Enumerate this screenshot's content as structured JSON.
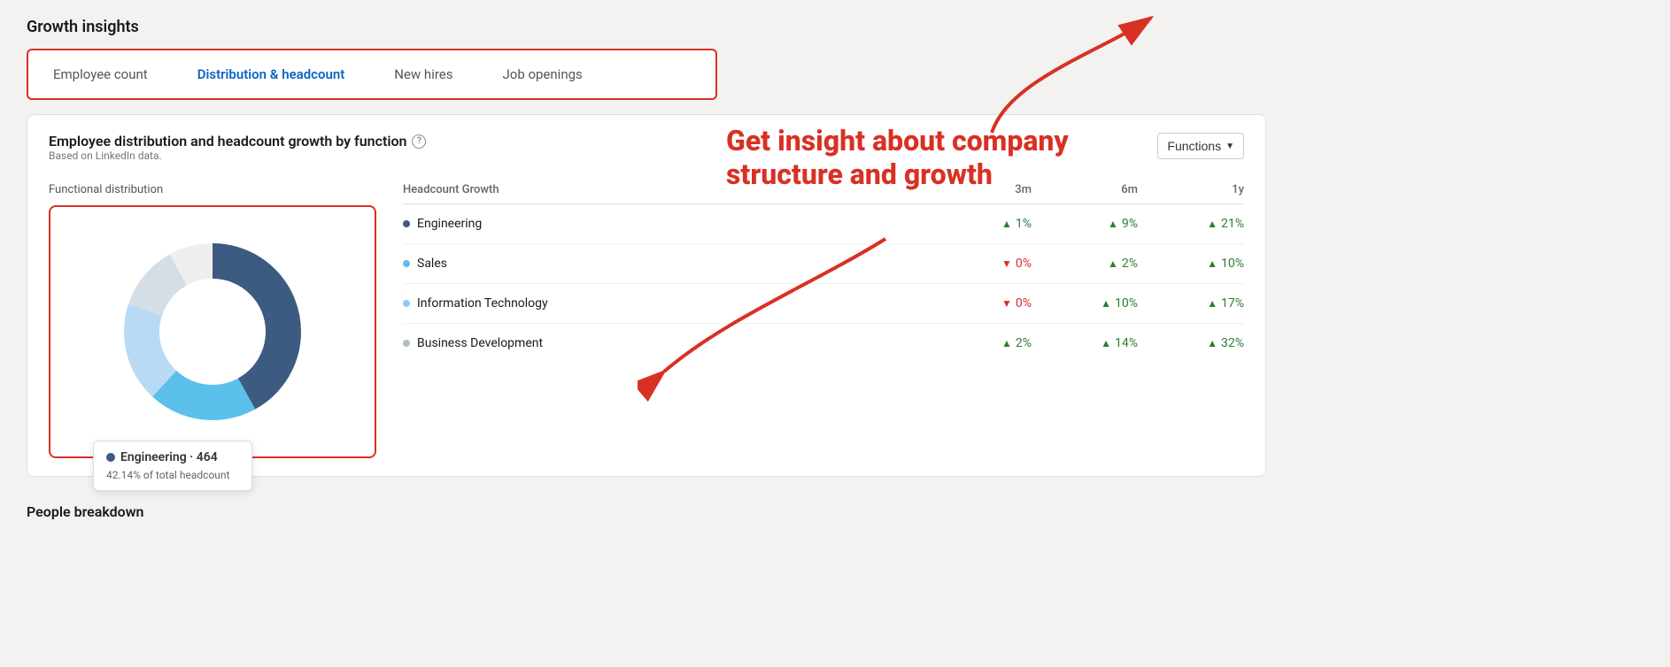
{
  "page": {
    "section_title": "Growth insights",
    "tabs": [
      {
        "id": "employee-count",
        "label": "Employee count",
        "active": false
      },
      {
        "id": "distribution-headcount",
        "label": "Distribution & headcount",
        "active": true
      },
      {
        "id": "new-hires",
        "label": "New hires",
        "active": false
      },
      {
        "id": "job-openings",
        "label": "Job openings",
        "active": false
      }
    ],
    "card": {
      "title": "Employee distribution and headcount growth by function",
      "subtitle": "Based on LinkedIn data.",
      "functions_button": "Functions",
      "chart_label": "Functional distribution",
      "tooltip": {
        "name": "Engineering",
        "count": "464",
        "percent": "42.14% of total headcount"
      },
      "table_headers": {
        "function": "Headcount Growth",
        "col3m": "3m",
        "col6m": "6m",
        "col1y": "1y"
      },
      "rows": [
        {
          "name": "Engineering",
          "dot_color": "#3d5a80",
          "m3": {
            "dir": "up",
            "val": "1%"
          },
          "m6": {
            "dir": "up",
            "val": "9%"
          },
          "y1": {
            "dir": "up",
            "val": "21%"
          }
        },
        {
          "name": "Sales",
          "dot_color": "#5bc0eb",
          "m3": {
            "dir": "down",
            "val": "0%"
          },
          "m6": {
            "dir": "up",
            "val": "2%"
          },
          "y1": {
            "dir": "up",
            "val": "10%"
          }
        },
        {
          "name": "Information Technology",
          "dot_color": "#90caf9",
          "m3": {
            "dir": "down",
            "val": "0%"
          },
          "m6": {
            "dir": "up",
            "val": "10%"
          },
          "y1": {
            "dir": "up",
            "val": "17%"
          }
        },
        {
          "name": "Business Development",
          "dot_color": "#b0bec5",
          "m3": {
            "dir": "up",
            "val": "2%"
          },
          "m6": {
            "dir": "up",
            "val": "14%"
          },
          "y1": {
            "dir": "up",
            "val": "32%"
          }
        }
      ]
    },
    "annotation": {
      "text": "Get insight about company structure and growth"
    },
    "bottom_section": "People breakdown"
  }
}
